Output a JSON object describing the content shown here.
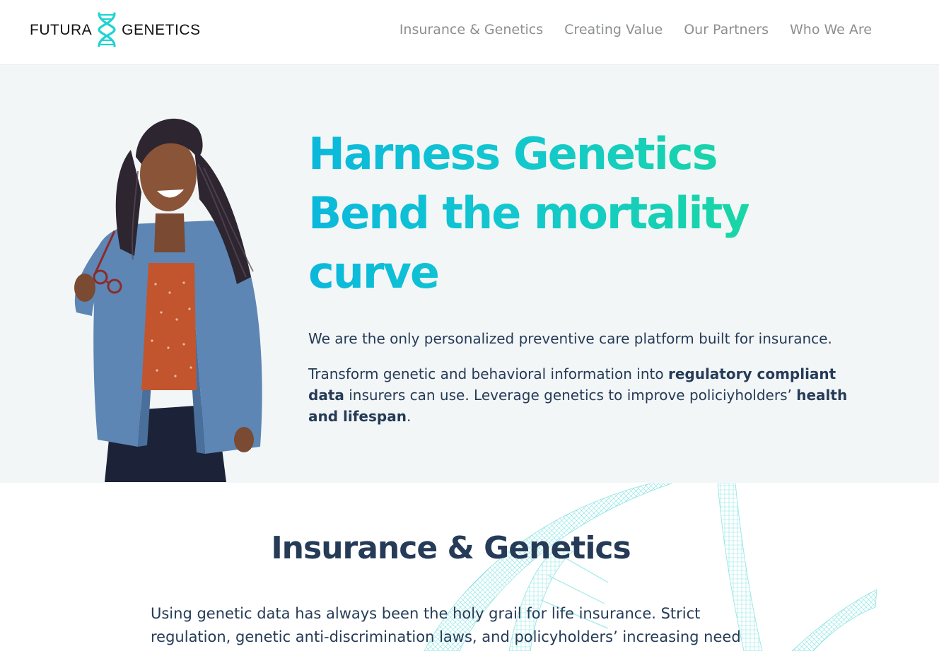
{
  "brand": {
    "word_left": "FUTURA",
    "word_right": "GENETICS",
    "accent_color": "#1fd3d3"
  },
  "nav": {
    "items": [
      {
        "label": "Insurance & Genetics"
      },
      {
        "label": "Creating Value"
      },
      {
        "label": "Our Partners"
      },
      {
        "label": "Who We Are"
      }
    ]
  },
  "hero": {
    "headline_lines": [
      "Harness Genetics",
      "Bend the mortality",
      "curve"
    ],
    "intro": "We are the only personalized preventive care platform built for insurance.",
    "body_part1": "Transform genetic and behavioral information into ",
    "body_bold1": "regulatory compliant data",
    "body_part2": " insurers can use. Leverage genetics to improve policiyholders’ ",
    "body_bold2": "health and lifespan",
    "body_part3": ".",
    "gradient_start": "#0bb8dc",
    "gradient_end": "#19d6a5",
    "background_color": "#f3f6f7"
  },
  "section": {
    "title": "Insurance & Genetics",
    "body": "Using genetic data has always been the holy grail for life insurance. Strict regulation, genetic anti-discrimination laws, and policyholders’ increasing need"
  }
}
